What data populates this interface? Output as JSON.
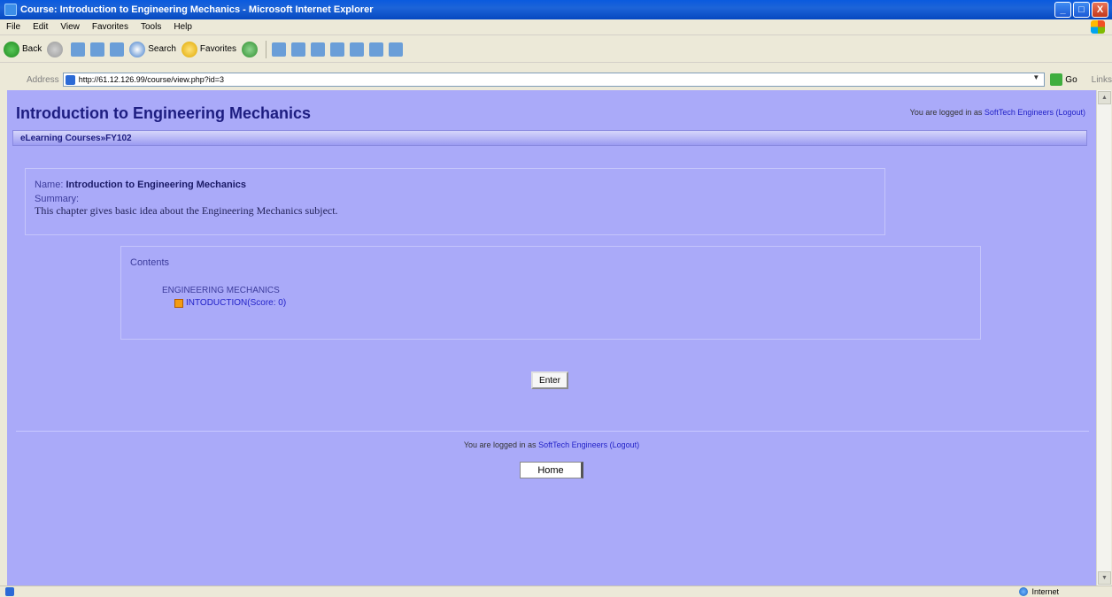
{
  "window": {
    "title": "Course: Introduction to Engineering Mechanics - Microsoft Internet Explorer",
    "controls": {
      "minimize": "_",
      "maximize": "□",
      "close": "X"
    }
  },
  "menu": [
    "File",
    "Edit",
    "View",
    "Favorites",
    "Tools",
    "Help"
  ],
  "toolbar": {
    "back": "Back",
    "search": "Search",
    "favorites": "Favorites"
  },
  "address": {
    "label": "Address",
    "url": "http://61.12.126.99/course/view.php?id=3",
    "go": "Go",
    "links": "Links"
  },
  "page": {
    "header": "Introduction to Engineering Mechanics",
    "login_top": {
      "prefix": "You are logged in as ",
      "user": "SoftTech Engineers",
      "logout": "(Logout)"
    },
    "breadcrumb": {
      "root": "eLearning Courses",
      "separator": "» ",
      "current": "FY102"
    },
    "summary": {
      "name_label": "Name:",
      "name_value": "Introduction to Engineering Mechanics",
      "summary_label": "Summary:",
      "summary_text": "This chapter gives basic idea about the Engineering Mechanics subject."
    },
    "contents": {
      "title": "Contents",
      "section": "ENGINEERING MECHANICS",
      "item": "INTODUCTION(Score: 0)"
    },
    "enter_button": "Enter",
    "footer_login": {
      "prefix": "You are logged in as ",
      "user": "SoftTech Engineers",
      "logout": "(Logout)"
    },
    "home_button": "Home"
  },
  "status": {
    "zone": "Internet"
  }
}
